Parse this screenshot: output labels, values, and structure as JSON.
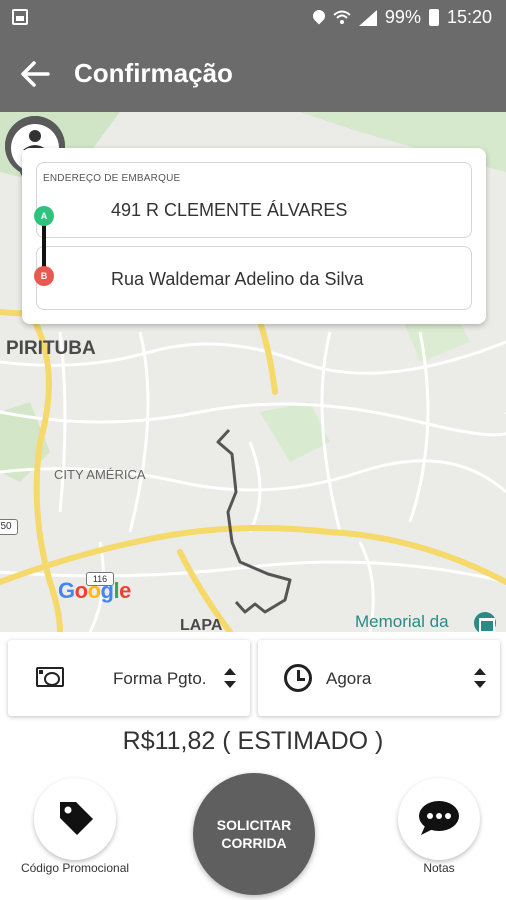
{
  "status_bar": {
    "battery": "99%",
    "time": "15:20"
  },
  "app_bar": {
    "title": "Confirmação"
  },
  "map": {
    "labels": {
      "pirituba": "PIRITUBA",
      "city_america": "CITY AMÉRICA",
      "lapa": "LAPA",
      "memorial": "Memorial da",
      "shield_116": "116",
      "shield_50": "50"
    }
  },
  "address_card": {
    "caption": "ENDEREÇO DE EMBARQUE",
    "origin_marker": "A",
    "destination_marker": "B",
    "origin": "491 R CLEMENTE ÁLVARES",
    "destination": "Rua Waldemar Adelino da Silva"
  },
  "payment": {
    "label": "Forma Pgto."
  },
  "schedule": {
    "label": "Agora"
  },
  "estimate": "R$11,82 ( ESTIMADO )",
  "actions": {
    "promo_label": "Código Promocional",
    "request_label": "SOLICITAR CORRIDA",
    "notes_label": "Notas"
  },
  "colors": {
    "bar": "#6b6b6b",
    "request_button": "#5f5f5f",
    "marker_origin": "#2ec27e",
    "marker_destination": "#e85a4f"
  }
}
